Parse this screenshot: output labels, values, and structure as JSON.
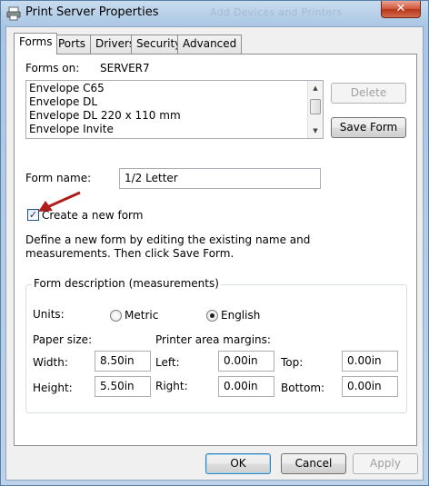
{
  "window": {
    "title": "Print Server Properties",
    "close_glyph": "✕",
    "background_title": "Add Devices and Printers"
  },
  "tabs": [
    {
      "label": "Forms",
      "active": true
    },
    {
      "label": "Ports",
      "active": false
    },
    {
      "label": "Drivers",
      "active": false
    },
    {
      "label": "Security",
      "active": false
    },
    {
      "label": "Advanced",
      "active": false
    }
  ],
  "forms": {
    "forms_on_label": "Forms on:",
    "server_name": "SERVER7",
    "list_items": [
      "Envelope C65",
      "Envelope DL",
      "Envelope DL 220 x 110 mm",
      "Envelope Invite"
    ],
    "scroll_up": "▲",
    "scroll_down": "▼",
    "delete_label": "Delete",
    "save_form_label": "Save Form",
    "form_name_label": "Form name:",
    "form_name_value": "1/2 Letter",
    "create_new_form_label": "Create a new form",
    "create_new_form_checked": true,
    "check_glyph": "✓",
    "description_line1": "Define a new form by editing the existing name and",
    "description_line2": "measurements. Then click Save Form."
  },
  "measurements": {
    "group_title": "Form description (measurements)",
    "units_label": "Units:",
    "metric_label": "Metric",
    "english_label": "English",
    "selected_unit": "English",
    "paper_size_label": "Paper size:",
    "printer_margins_label": "Printer area margins:",
    "width_label": "Width:",
    "width_value": "8.50in",
    "height_label": "Height:",
    "height_value": "5.50in",
    "left_label": "Left:",
    "left_value": "0.00in",
    "right_label": "Right:",
    "right_value": "0.00in",
    "top_label": "Top:",
    "top_value": "0.00in",
    "bottom_label": "Bottom:",
    "bottom_value": "0.00in"
  },
  "footer": {
    "ok_label": "OK",
    "cancel_label": "Cancel",
    "apply_label": "Apply"
  },
  "colors": {
    "annotation_arrow": "#b01c1c",
    "close_button": "#c84a2e",
    "default_button_border": "#3c7fb1"
  }
}
